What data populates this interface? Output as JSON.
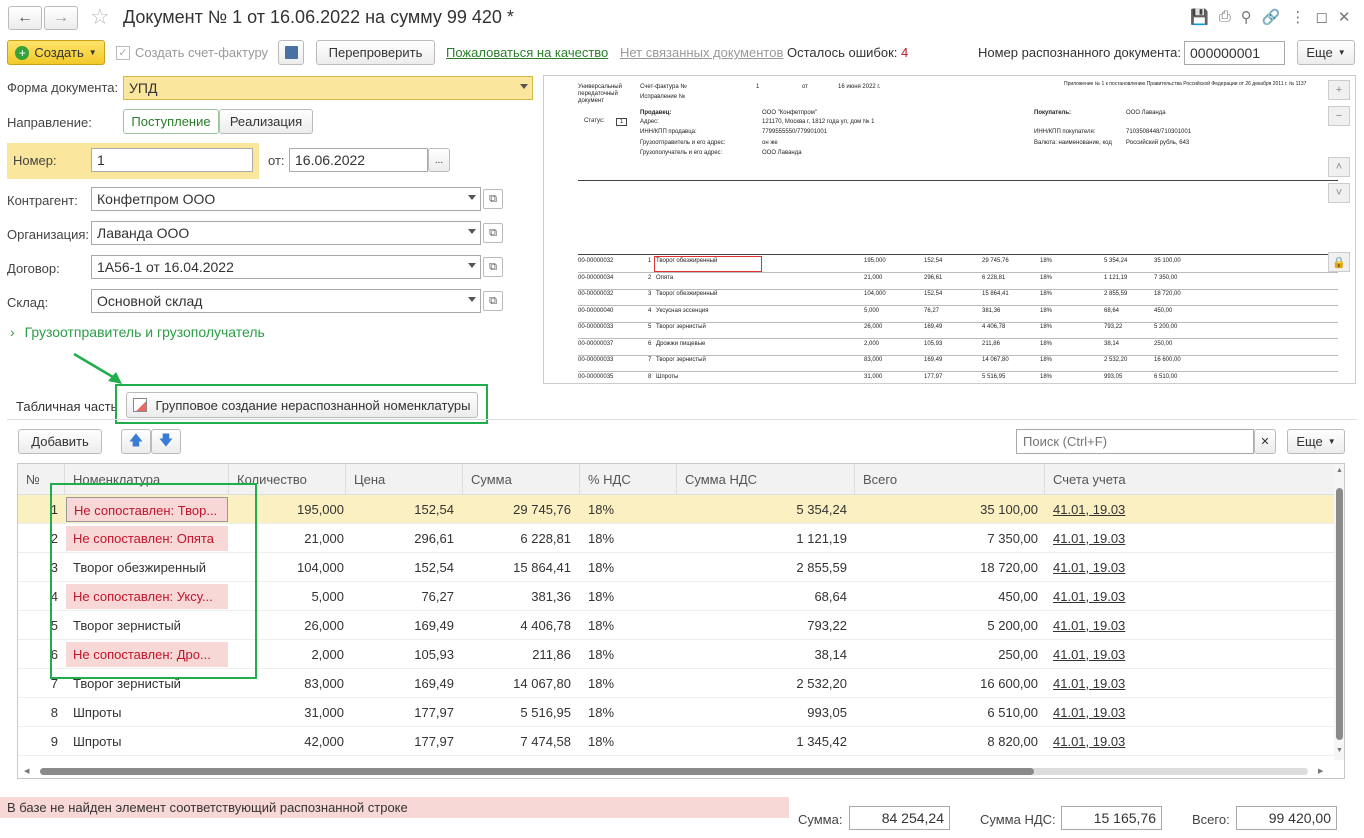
{
  "window": {
    "title": "Документ № 1 от 16.06.2022 на сумму 99 420 *"
  },
  "toolbar": {
    "create": "Создать",
    "create_invoice": "Создать счет-фактуру",
    "recheck": "Перепроверить",
    "complain": "Пожаловаться на качество",
    "no_related": "Нет связанных документов",
    "errors_label": "Осталось ошибок:",
    "errors_count": "4",
    "recognized_label": "Номер распознанного документа:",
    "recognized_value": "000000001",
    "more": "Еще"
  },
  "form": {
    "doc_form_label": "Форма документа:",
    "doc_form_value": "УПД",
    "direction_label": "Направление:",
    "direction_in": "Поступление",
    "direction_out": "Реализация",
    "number_label": "Номер:",
    "number_value": "1",
    "date_label": "от:",
    "date_value": "16.06.2022",
    "contractor_label": "Контрагент:",
    "contractor_value": "Конфетпром ООО",
    "org_label": "Организация:",
    "org_value": "Лаванда ООО",
    "contract_label": "Договор:",
    "contract_value": "1А56-1 от 16.04.2022",
    "warehouse_label": "Склад:",
    "warehouse_value": "Основной склад",
    "shipper_link": "Грузоотправитель и грузополучатель"
  },
  "preview": {
    "h1": "Универсальный",
    "h2": "передаточный",
    "h3": "документ",
    "invoice": "Счет-фактура №",
    "inv_no": "1",
    "from": "от",
    "inv_date": "16 июня 2022 г.",
    "fix": "Исправление №",
    "status": "Статус:",
    "status_val": "1",
    "seller": "Продавец:",
    "seller_val": "ООО \"Конфетпром\"",
    "addr": "Адрес:",
    "addr_val": "121170, Москва г, 1812 года ул, дом № 1",
    "inn": "ИНН/КПП продавца:",
    "inn_val": "7799555550/779901001",
    "shipper": "Грузоотправитель и его адрес:",
    "shipper_val": "он же",
    "consignee": "Грузополучатель и его адрес:",
    "consignee_val": "ООО Лаванда",
    "buyer": "Покупатель:",
    "buyer_val": "ООО Лаванда",
    "buyer_inn": "ИНН/КПП покупателя:",
    "buyer_inn_val": "7103508448/710301001",
    "currency": "Валюта: наименование, код",
    "currency_val": "Российский рубль, 643",
    "appendix": "Приложение № 1 к постановлению Правительства Российской Федерации от 26 декабря 2011 г. № 1137",
    "rows": [
      {
        "code": "00-00000032",
        "n": "1",
        "name": "Творог обезжиренный",
        "qty": "195,000",
        "price": "152,54",
        "sum": "29 745,76",
        "vat": "18%",
        "vsum": "5 354,24",
        "total": "35 100,00"
      },
      {
        "code": "00-00000034",
        "n": "2",
        "name": "Опята",
        "qty": "21,000",
        "price": "296,61",
        "sum": "6 228,81",
        "vat": "18%",
        "vsum": "1 121,19",
        "total": "7 350,00"
      },
      {
        "code": "00-00000032",
        "n": "3",
        "name": "Творог обезжиренный",
        "qty": "104,000",
        "price": "152,54",
        "sum": "15 864,41",
        "vat": "18%",
        "vsum": "2 855,59",
        "total": "18 720,00"
      },
      {
        "code": "00-00000040",
        "n": "4",
        "name": "Уксусная эссенция",
        "qty": "5,000",
        "price": "76,27",
        "sum": "381,36",
        "vat": "18%",
        "vsum": "68,64",
        "total": "450,00"
      },
      {
        "code": "00-00000033",
        "n": "5",
        "name": "Творог зернистый",
        "qty": "26,000",
        "price": "169,49",
        "sum": "4 406,78",
        "vat": "18%",
        "vsum": "793,22",
        "total": "5 200,00"
      },
      {
        "code": "00-00000037",
        "n": "6",
        "name": "Дрожжи пищевые",
        "qty": "2,000",
        "price": "105,93",
        "sum": "211,86",
        "vat": "18%",
        "vsum": "38,14",
        "total": "250,00"
      },
      {
        "code": "00-00000033",
        "n": "7",
        "name": "Творог зернистый",
        "qty": "83,000",
        "price": "169,49",
        "sum": "14 067,80",
        "vat": "18%",
        "vsum": "2 532,20",
        "total": "16 600,00"
      },
      {
        "code": "00-00000035",
        "n": "8",
        "name": "Шпроты",
        "qty": "31,000",
        "price": "177,97",
        "sum": "5 516,95",
        "vat": "18%",
        "vsum": "993,05",
        "total": "6 510,00"
      }
    ]
  },
  "tabs": {
    "table_part": "Табличная часть",
    "group_create": "Групповое создание нераспознанной номенклатуры"
  },
  "table_toolbar": {
    "add": "Добавить",
    "search_placeholder": "Поиск (Ctrl+F)",
    "more": "Еще"
  },
  "columns": [
    "№",
    "Номенклатура",
    "Количество",
    "Цена",
    "Сумма",
    "% НДС",
    "Сумма НДС",
    "Всего",
    "Счета учета"
  ],
  "rows": [
    {
      "n": "1",
      "item": "Не сопоставлен: Твор...",
      "unmatched": true,
      "qty": "195,000",
      "price": "152,54",
      "sum": "29 745,76",
      "vat": "18%",
      "vsum": "5 354,24",
      "total": "35 100,00",
      "acc": "41.01, 19.03"
    },
    {
      "n": "2",
      "item": "Не сопоставлен: Опята",
      "unmatched": true,
      "qty": "21,000",
      "price": "296,61",
      "sum": "6 228,81",
      "vat": "18%",
      "vsum": "1 121,19",
      "total": "7 350,00",
      "acc": "41.01, 19.03"
    },
    {
      "n": "3",
      "item": "Творог обезжиренный",
      "unmatched": false,
      "qty": "104,000",
      "price": "152,54",
      "sum": "15 864,41",
      "vat": "18%",
      "vsum": "2 855,59",
      "total": "18 720,00",
      "acc": "41.01, 19.03"
    },
    {
      "n": "4",
      "item": "Не сопоставлен: Уксу...",
      "unmatched": true,
      "qty": "5,000",
      "price": "76,27",
      "sum": "381,36",
      "vat": "18%",
      "vsum": "68,64",
      "total": "450,00",
      "acc": "41.01, 19.03"
    },
    {
      "n": "5",
      "item": "Творог зернистый",
      "unmatched": false,
      "qty": "26,000",
      "price": "169,49",
      "sum": "4 406,78",
      "vat": "18%",
      "vsum": "793,22",
      "total": "5 200,00",
      "acc": "41.01, 19.03"
    },
    {
      "n": "6",
      "item": "Не сопоставлен: Дро...",
      "unmatched": true,
      "qty": "2,000",
      "price": "105,93",
      "sum": "211,86",
      "vat": "18%",
      "vsum": "38,14",
      "total": "250,00",
      "acc": "41.01, 19.03"
    },
    {
      "n": "7",
      "item": "Творог зернистый",
      "unmatched": false,
      "qty": "83,000",
      "price": "169,49",
      "sum": "14 067,80",
      "vat": "18%",
      "vsum": "2 532,20",
      "total": "16 600,00",
      "acc": "41.01, 19.03"
    },
    {
      "n": "8",
      "item": "Шпроты",
      "unmatched": false,
      "qty": "31,000",
      "price": "177,97",
      "sum": "5 516,95",
      "vat": "18%",
      "vsum": "993,05",
      "total": "6 510,00",
      "acc": "41.01, 19.03"
    },
    {
      "n": "9",
      "item": "Шпроты",
      "unmatched": false,
      "qty": "42,000",
      "price": "177,97",
      "sum": "7 474,58",
      "vat": "18%",
      "vsum": "1 345,42",
      "total": "8 820,00",
      "acc": "41.01, 19.03"
    }
  ],
  "footer": {
    "message": "В базе не найден элемент соответствующий распознанной строке",
    "sum_label": "Сумма:",
    "sum_value": "84 254,24",
    "vat_label": "Сумма НДС:",
    "vat_value": "15 165,76",
    "total_label": "Всего:",
    "total_value": "99 420,00"
  },
  "colors": {
    "accent_yellow": "#f5d23c",
    "highlight_green": "#1fae4b",
    "unmatched_bg": "#f8d7d7",
    "unmatched_text": "#c0152a",
    "selected_row": "#fbf0c2"
  }
}
